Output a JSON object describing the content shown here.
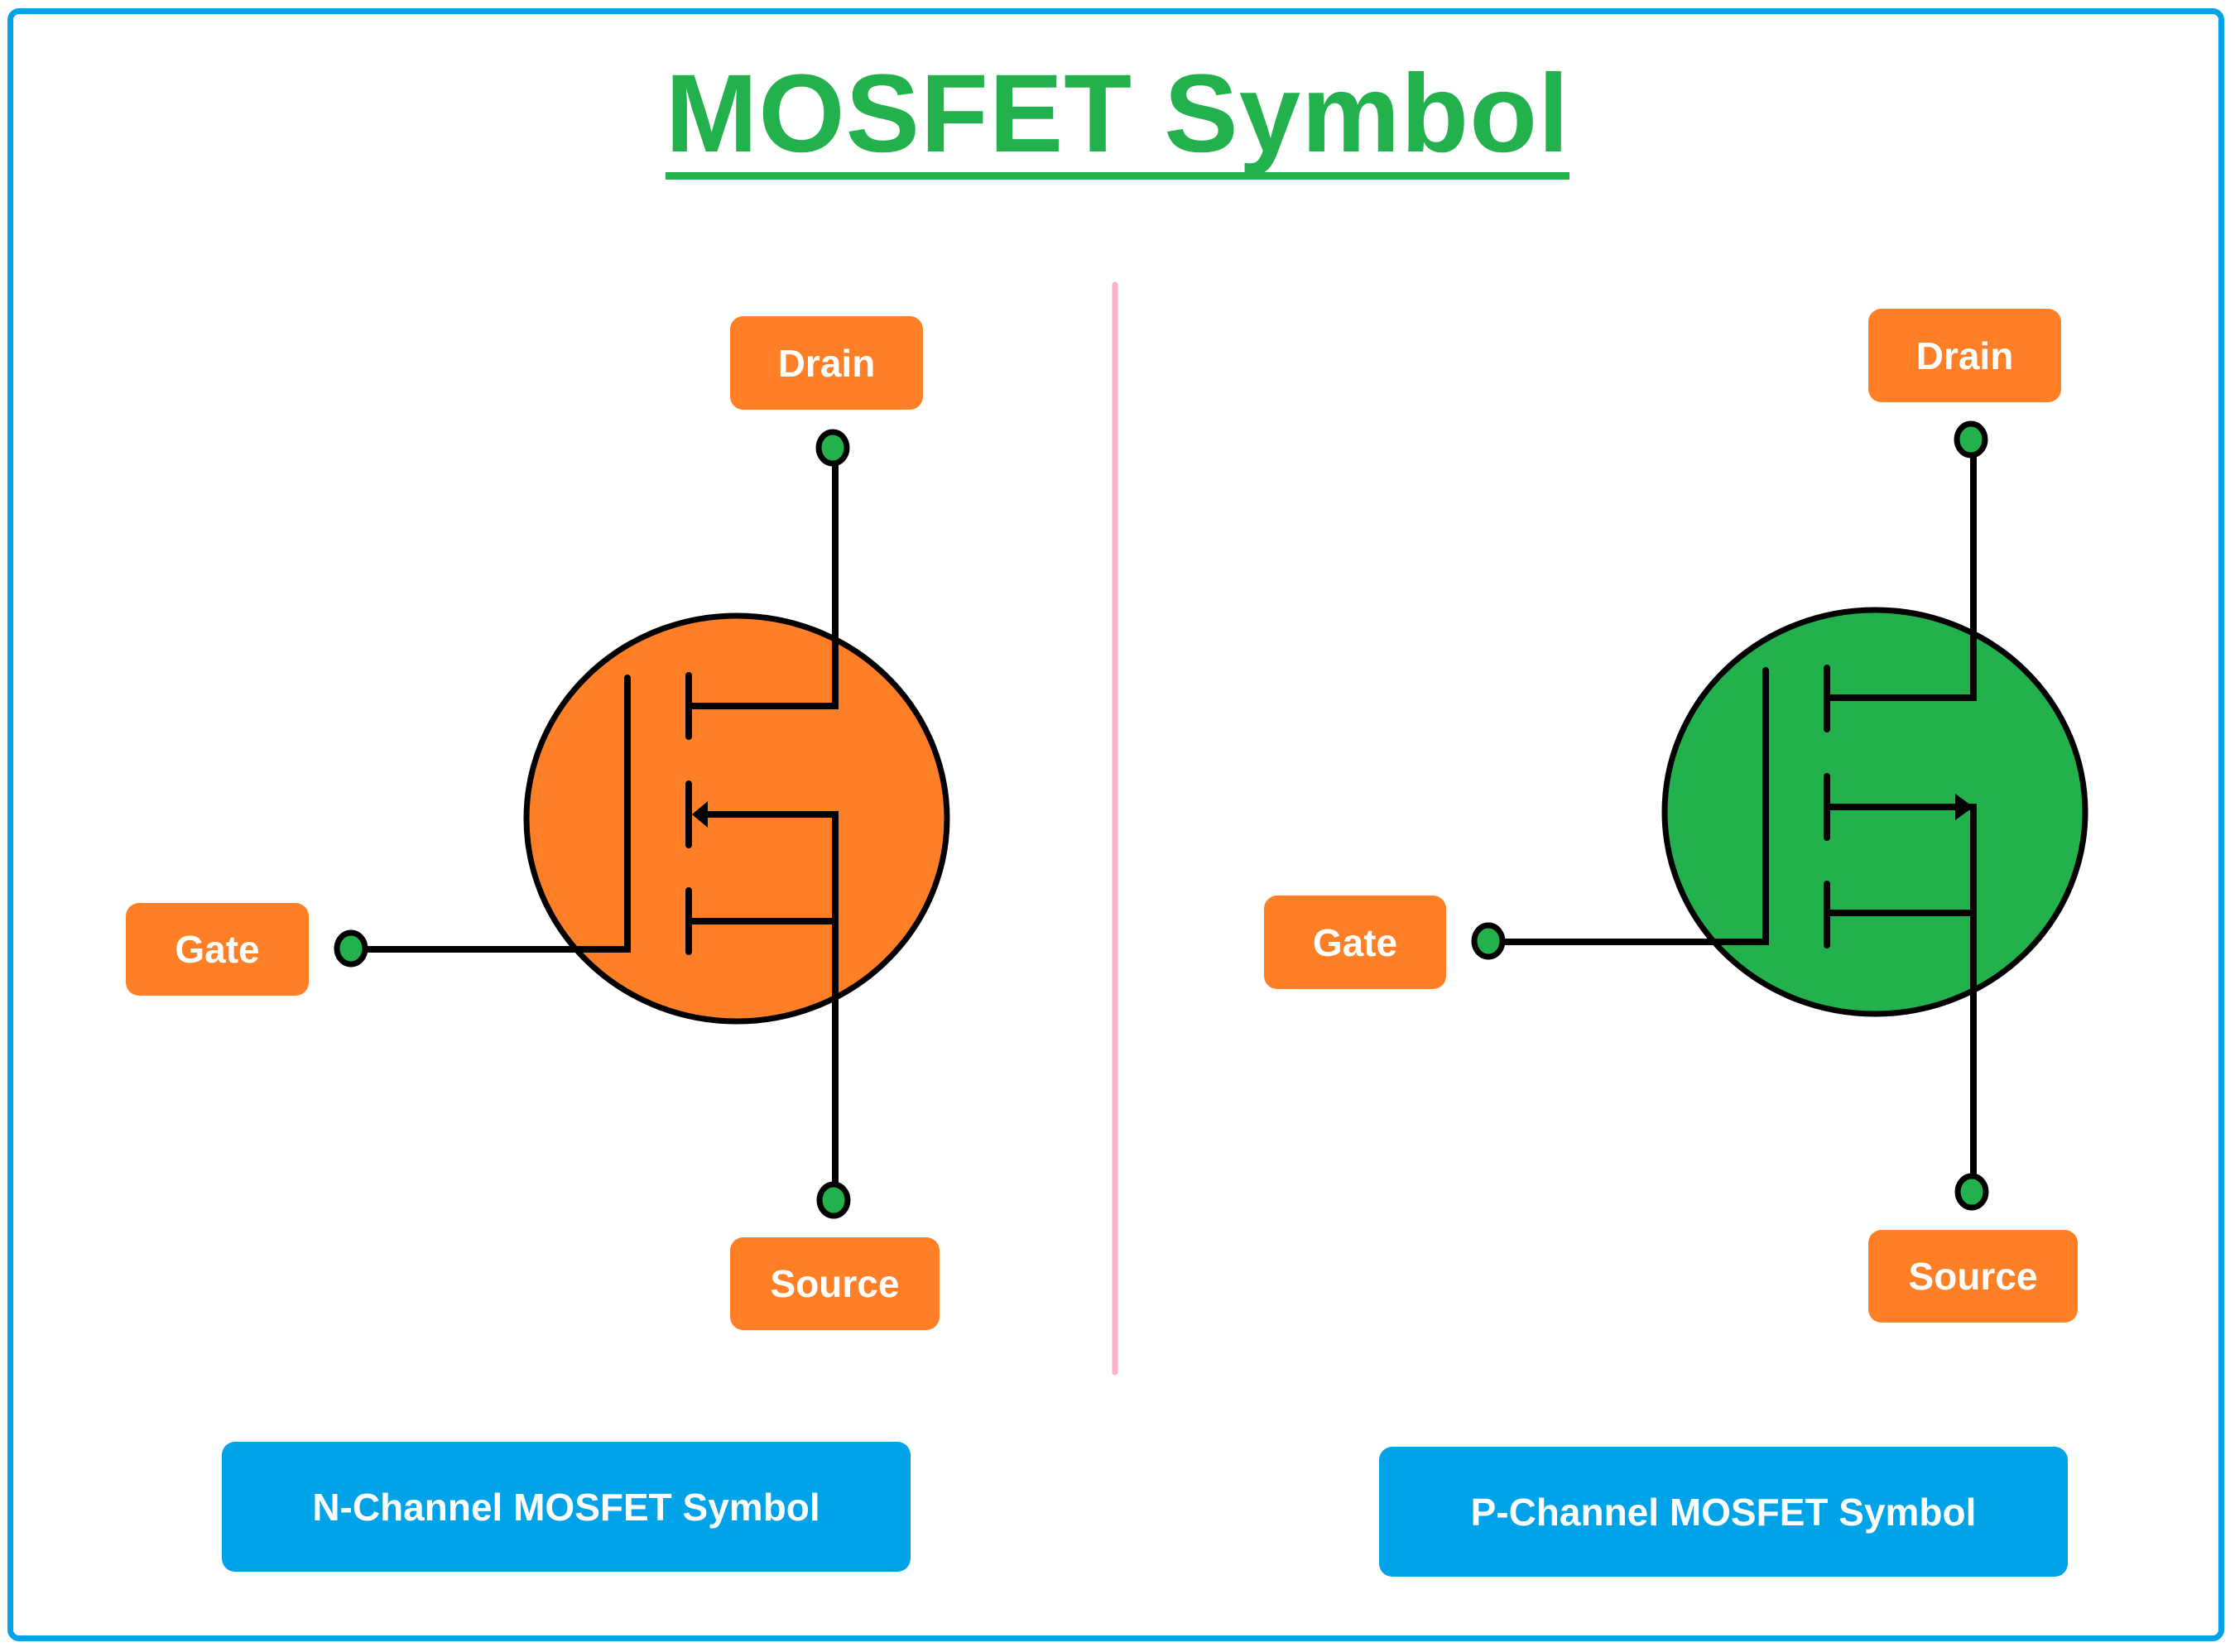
{
  "title": "MOSFET Symbol",
  "colors": {
    "frame": "#00A2E8",
    "title": "#22B14C",
    "divider": "#FFAFC9",
    "label_box": "#FF7F27",
    "caption_box": "#00A2E8",
    "n_channel_body": "#FF7F27",
    "p_channel_body": "#22B14C",
    "terminal_dot": "#22B14C",
    "wire": "#000000"
  },
  "symbols": [
    {
      "id": "n-channel",
      "caption": "N-Channel MOSFET Symbol",
      "arrow_direction": "inward",
      "terminals": {
        "drain": "Drain",
        "gate": "Gate",
        "source": "Source"
      }
    },
    {
      "id": "p-channel",
      "caption": "P-Channel MOSFET Symbol",
      "arrow_direction": "outward",
      "terminals": {
        "drain": "Drain",
        "gate": "Gate",
        "source": "Source"
      }
    }
  ]
}
